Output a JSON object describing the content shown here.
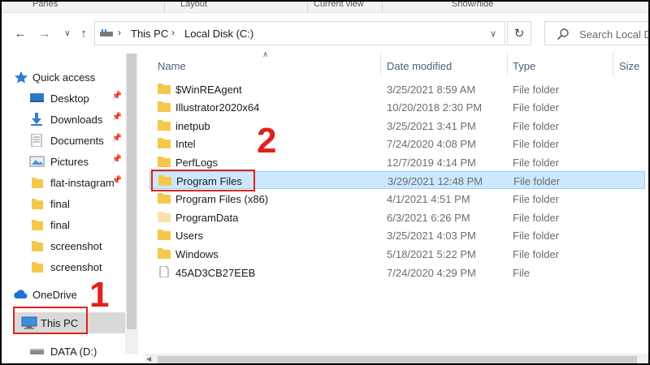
{
  "ribbon": {
    "groups": [
      "Panes",
      "Layout",
      "Current view",
      "Show/hide"
    ]
  },
  "address_bar": {
    "path": [
      "This PC",
      "Local Disk (C:)"
    ]
  },
  "search": {
    "placeholder": "Search Local Disk (C:)"
  },
  "nav_pane": {
    "items": [
      {
        "label": "Quick access",
        "icon": "star-icon",
        "pinned": false
      },
      {
        "label": "Desktop",
        "icon": "desktop-icon",
        "pinned": true
      },
      {
        "label": "Downloads",
        "icon": "download-icon",
        "pinned": true
      },
      {
        "label": "Documents",
        "icon": "documents-icon",
        "pinned": true
      },
      {
        "label": "Pictures",
        "icon": "pictures-icon",
        "pinned": true
      },
      {
        "label": "flat-instagram",
        "icon": "folder-icon",
        "pinned": true
      },
      {
        "label": "final",
        "icon": "folder-icon",
        "pinned": false
      },
      {
        "label": "final",
        "icon": "folder-icon",
        "pinned": false
      },
      {
        "label": "screenshot",
        "icon": "folder-icon",
        "pinned": false
      },
      {
        "label": "screenshot",
        "icon": "folder-icon",
        "pinned": false
      },
      {
        "label": "OneDrive",
        "icon": "cloud-icon",
        "pinned": false
      },
      {
        "label": "This PC",
        "icon": "monitor-icon",
        "pinned": false,
        "selected": true
      },
      {
        "label": "DATA (D:)",
        "icon": "drive-icon",
        "pinned": false
      }
    ]
  },
  "columns": {
    "name": "Name",
    "date_modified": "Date modified",
    "type": "Type",
    "size": "Size"
  },
  "files": [
    {
      "name": "$WinREAgent",
      "date": "3/25/2021 8:59 AM",
      "type": "File folder",
      "kind": "folder"
    },
    {
      "name": "Illustrator2020x64",
      "date": "10/20/2018 2:30 PM",
      "type": "File folder",
      "kind": "folder"
    },
    {
      "name": "inetpub",
      "date": "3/25/2021 3:41 PM",
      "type": "File folder",
      "kind": "folder"
    },
    {
      "name": "Intel",
      "date": "7/24/2020 4:08 PM",
      "type": "File folder",
      "kind": "folder"
    },
    {
      "name": "PerfLogs",
      "date": "12/7/2019 4:14 PM",
      "type": "File folder",
      "kind": "folder"
    },
    {
      "name": "Program Files",
      "date": "3/29/2021 12:48 PM",
      "type": "File folder",
      "kind": "folder",
      "selected": true
    },
    {
      "name": "Program Files (x86)",
      "date": "4/1/2021 4:51 PM",
      "type": "File folder",
      "kind": "folder"
    },
    {
      "name": "ProgramData",
      "date": "6/3/2021 6:26 PM",
      "type": "File folder",
      "kind": "folder-light"
    },
    {
      "name": "Users",
      "date": "3/25/2021 4:03 PM",
      "type": "File folder",
      "kind": "folder"
    },
    {
      "name": "Windows",
      "date": "5/18/2021 5:22 PM",
      "type": "File folder",
      "kind": "folder"
    },
    {
      "name": "45AD3CB27EEB",
      "date": "7/24/2020 4:29 PM",
      "type": "File",
      "kind": "file"
    }
  ],
  "annotations": {
    "step1": "1",
    "step2": "2",
    "color": "#e0211d"
  },
  "colors": {
    "selection_bg": "#cce8ff",
    "selection_border": "#99d1ff",
    "folder": "#f5c84c",
    "header_text": "#4c607a"
  }
}
